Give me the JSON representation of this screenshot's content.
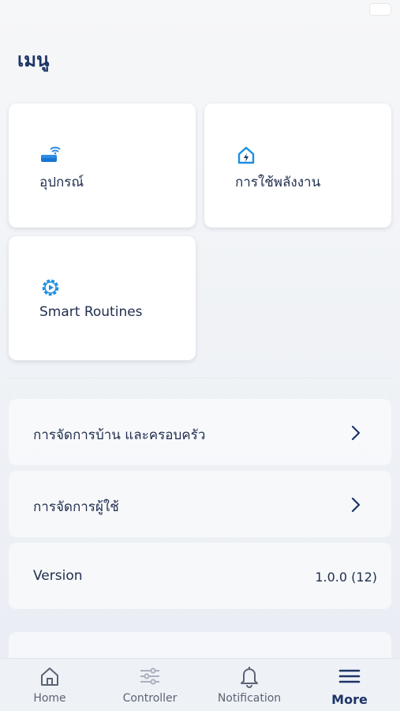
{
  "header": {
    "title": "เมนู"
  },
  "tiles": [
    {
      "label": "อุปกรณ์",
      "icon": "router-wifi-icon"
    },
    {
      "label": "การใช้พลังงาน",
      "icon": "home-energy-icon"
    },
    {
      "label": "Smart Routines",
      "icon": "gear-play-icon"
    }
  ],
  "rows": [
    {
      "label": "การจัดการบ้าน และครอบครัว"
    },
    {
      "label": "การจัดการผู้ใช้"
    },
    {
      "label": "Version",
      "value": "1.0.0 (12)"
    }
  ],
  "tabbar": {
    "items": [
      {
        "label": "Home",
        "icon": "home-icon"
      },
      {
        "label": "Controller",
        "icon": "sliders-icon"
      },
      {
        "label": "Notification",
        "icon": "bell-icon"
      },
      {
        "label": "More",
        "icon": "menu-icon",
        "active": true
      }
    ]
  },
  "colors": {
    "accent": "#1d8fe1",
    "title": "#1d3566",
    "text": "#1f2d4d"
  }
}
